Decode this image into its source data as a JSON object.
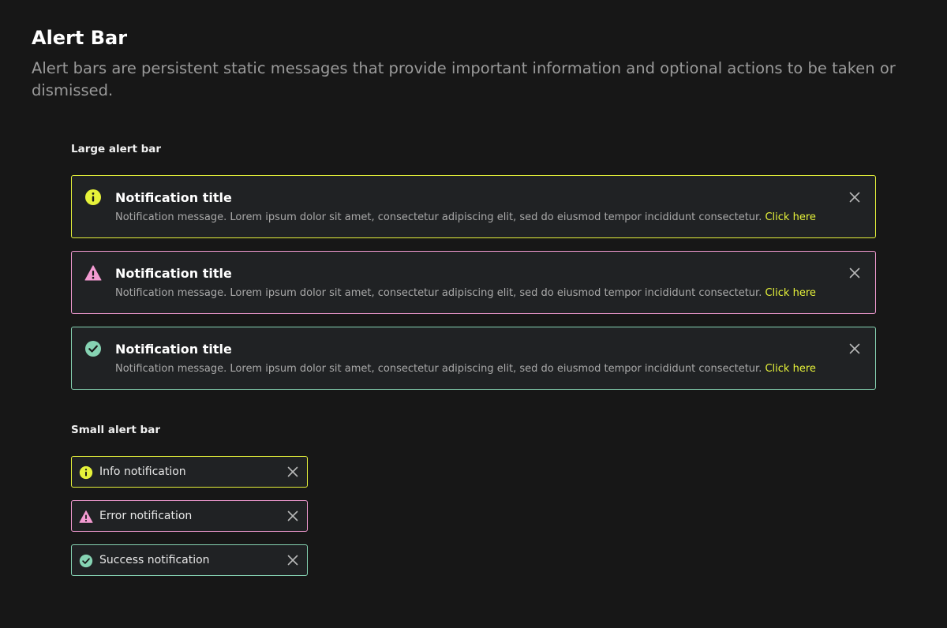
{
  "page": {
    "title": "Alert Bar",
    "description": "Alert bars are persistent static messages that provide important information and optional actions to be taken or dismissed."
  },
  "large_section": {
    "label": "Large alert bar",
    "alerts": [
      {
        "type": "info",
        "icon": "info-icon",
        "color": "#e6f23a",
        "title": "Notification title",
        "message": "Notification message. Lorem ipsum dolor sit amet, consectetur adipiscing elit, sed do eiusmod tempor incididunt consectetur.",
        "link": "Click here"
      },
      {
        "type": "error",
        "icon": "warning-icon",
        "color": "#f39bd2",
        "title": "Notification title",
        "message": "Notification message. Lorem ipsum dolor sit amet, consectetur adipiscing elit, sed do eiusmod tempor incididunt consectetur.",
        "link": "Click here"
      },
      {
        "type": "success",
        "icon": "check-circle-icon",
        "color": "#86d3b3",
        "title": "Notification title",
        "message": "Notification message. Lorem ipsum dolor sit amet, consectetur adipiscing elit, sed do eiusmod tempor incididunt consectetur.",
        "link": "Click here"
      }
    ]
  },
  "small_section": {
    "label": "Small alert bar",
    "alerts": [
      {
        "type": "info",
        "icon": "info-icon",
        "color": "#e6f23a",
        "label": "Info notification"
      },
      {
        "type": "error",
        "icon": "warning-icon",
        "color": "#f39bd2",
        "label": "Error notification"
      },
      {
        "type": "success",
        "icon": "check-circle-icon",
        "color": "#86d3b3",
        "label": "Success notification"
      }
    ]
  },
  "theme": {
    "background": "#171717",
    "alert_background": "#202224",
    "link_color": "#e6f23a",
    "close_icon": "close-icon"
  }
}
